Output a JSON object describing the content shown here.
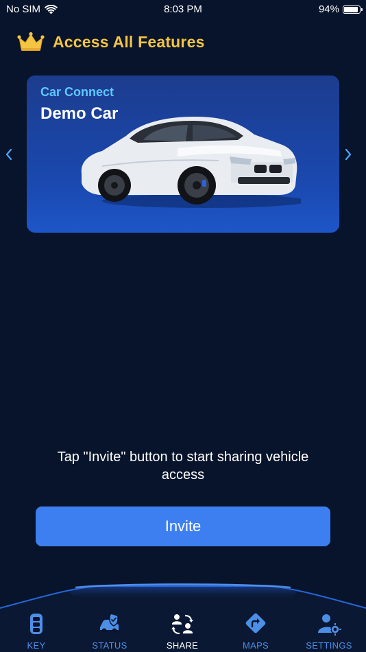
{
  "status_bar": {
    "carrier": "No SIM",
    "time": "8:03 PM",
    "battery": "94%"
  },
  "premium": {
    "label": "Access All Features",
    "icon": "crown-icon"
  },
  "vehicle_card": {
    "brand": "Car Connect",
    "name": "Demo Car"
  },
  "share": {
    "message": "Tap \"Invite\" button to start sharing vehicle access",
    "invite_label": "Invite"
  },
  "tabs": [
    {
      "label": "KEY",
      "icon": "key-fob-icon"
    },
    {
      "label": "STATUS",
      "icon": "car-status-icon"
    },
    {
      "label": "SHARE",
      "icon": "share-users-icon",
      "active": true
    },
    {
      "label": "MAPS",
      "icon": "directions-icon"
    },
    {
      "label": "SETTINGS",
      "icon": "user-settings-icon"
    }
  ],
  "colors": {
    "background": "#08142b",
    "accent": "#3d7ff0",
    "premium": "#f4c443",
    "brand": "#5ec8ff",
    "tab_inactive": "#4c8fe6"
  }
}
